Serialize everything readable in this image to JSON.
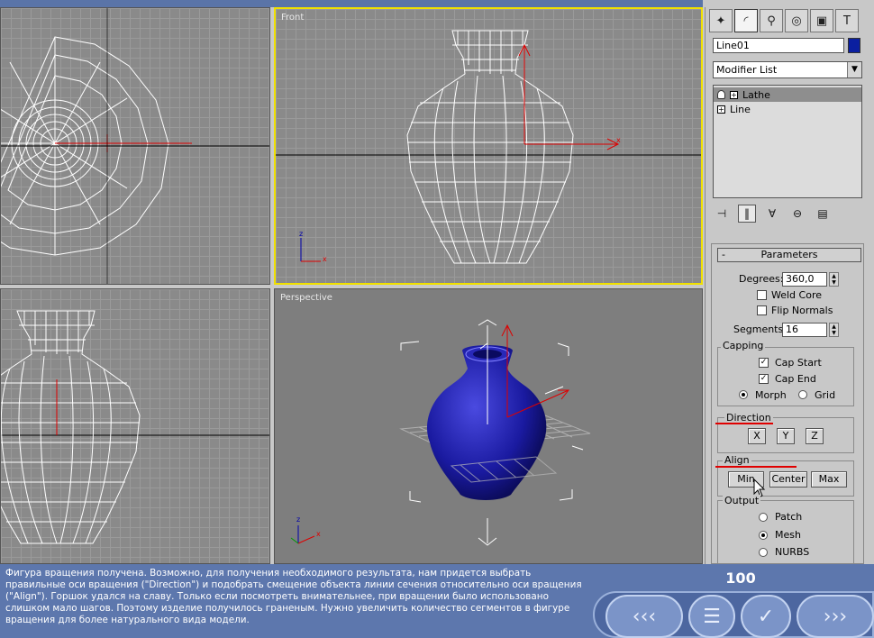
{
  "viewports": {
    "front_label": "Front",
    "perspective_label": "Perspective"
  },
  "panel": {
    "object_name": "Line01",
    "object_color": "#0b1fa0",
    "modifier_list": "Modifier List",
    "stack": [
      {
        "label": "Lathe",
        "selected": true
      },
      {
        "label": "Line",
        "selected": false
      }
    ],
    "tab_icons": [
      "create-icon",
      "modify-icon",
      "hierarchy-icon",
      "motion-icon",
      "display-icon",
      "utilities-icon"
    ],
    "rollout_title": "Parameters",
    "degrees_label": "Degrees:",
    "degrees_value": "360,0",
    "weld_core": "Weld Core",
    "flip_normals": "Flip Normals",
    "segments_label": "Segments:",
    "segments_value": "16",
    "capping_title": "Capping",
    "cap_start": "Cap Start",
    "cap_end": "Cap End",
    "morph": "Morph",
    "grid": "Grid",
    "direction_title": "Direction",
    "dir_x": "X",
    "dir_y": "Y",
    "dir_z": "Z",
    "align_title": "Align",
    "align_min": "Min",
    "align_center": "Center",
    "align_max": "Max",
    "output_title": "Output",
    "out_patch": "Patch",
    "out_mesh": "Mesh",
    "out_nurbs": "NURBS"
  },
  "bottom": {
    "description": "Фигура вращения получена. Возможно, для получения необходимого результата, нам придется выбрать правильные оси вращения (\"Direction\") и подобрать смещение объекта линии сечения относительно оси вращения (\"Align\"). Горшок удался на славу. Только если посмотреть внимательнее, при вращении было использовано слишком мало шагов. Поэтому изделие получилось граненым. Нужно увеличить количество сегментов в фигуре вращения для более натурального вида модели.",
    "page_number": "100"
  },
  "colors": {
    "accent": "#5d77ad",
    "active_viewport": "#f0e000",
    "vase": "#1a1aa0"
  }
}
